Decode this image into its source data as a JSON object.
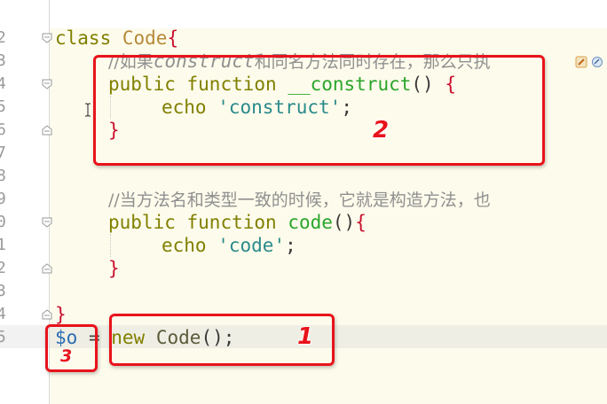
{
  "colors": {
    "keyword": "#808000",
    "class_name": "#b58a3a",
    "brace": "#c8102e",
    "string": "#2a8a8a",
    "function_name": "#2aa52a",
    "comment": "#909090",
    "variable": "#2b6cb3",
    "annotation_red": "#e8131b",
    "editor_background": "#fdfbeb",
    "current_line": "#efeee4"
  },
  "line_numbers": [
    "2",
    "3",
    "4",
    "5",
    "6",
    "7",
    "8",
    "9",
    "0",
    "1",
    "2",
    "3",
    "4",
    "5"
  ],
  "code": {
    "l2": {
      "kw": "class",
      "name": "Code",
      "brace": "{"
    },
    "l3": {
      "comment_a": "//如果",
      "comment_b": "construct",
      "comment_c": "和同名方法同时存在，那么只执"
    },
    "l4": {
      "kw1": "public",
      "kw2": "function",
      "name": "__construct",
      "parens": "()",
      "brace": "{"
    },
    "l5": {
      "kw": "echo",
      "str": "'construct'",
      "semi": ";"
    },
    "l6": {
      "brace": "}"
    },
    "l9": {
      "comment": "//当方法名和类型一致的时候，它就是构造方法，也"
    },
    "l10": {
      "kw1": "public",
      "kw2": "function",
      "name": "code",
      "parens": "()",
      "brace": "{"
    },
    "l11": {
      "kw": "echo",
      "str": "'code'",
      "semi": ";"
    },
    "l12": {
      "brace": "}"
    },
    "l14": {
      "brace": "}"
    },
    "l15": {
      "var": "$o",
      "op": "=",
      "kw": "new",
      "name": "Code",
      "tail": "();"
    }
  },
  "annotations": {
    "one": "1",
    "two": "2",
    "three": "3"
  },
  "icons": [
    "fold-marker-icon",
    "text-cursor-icon",
    "inspection-hint-icon"
  ]
}
